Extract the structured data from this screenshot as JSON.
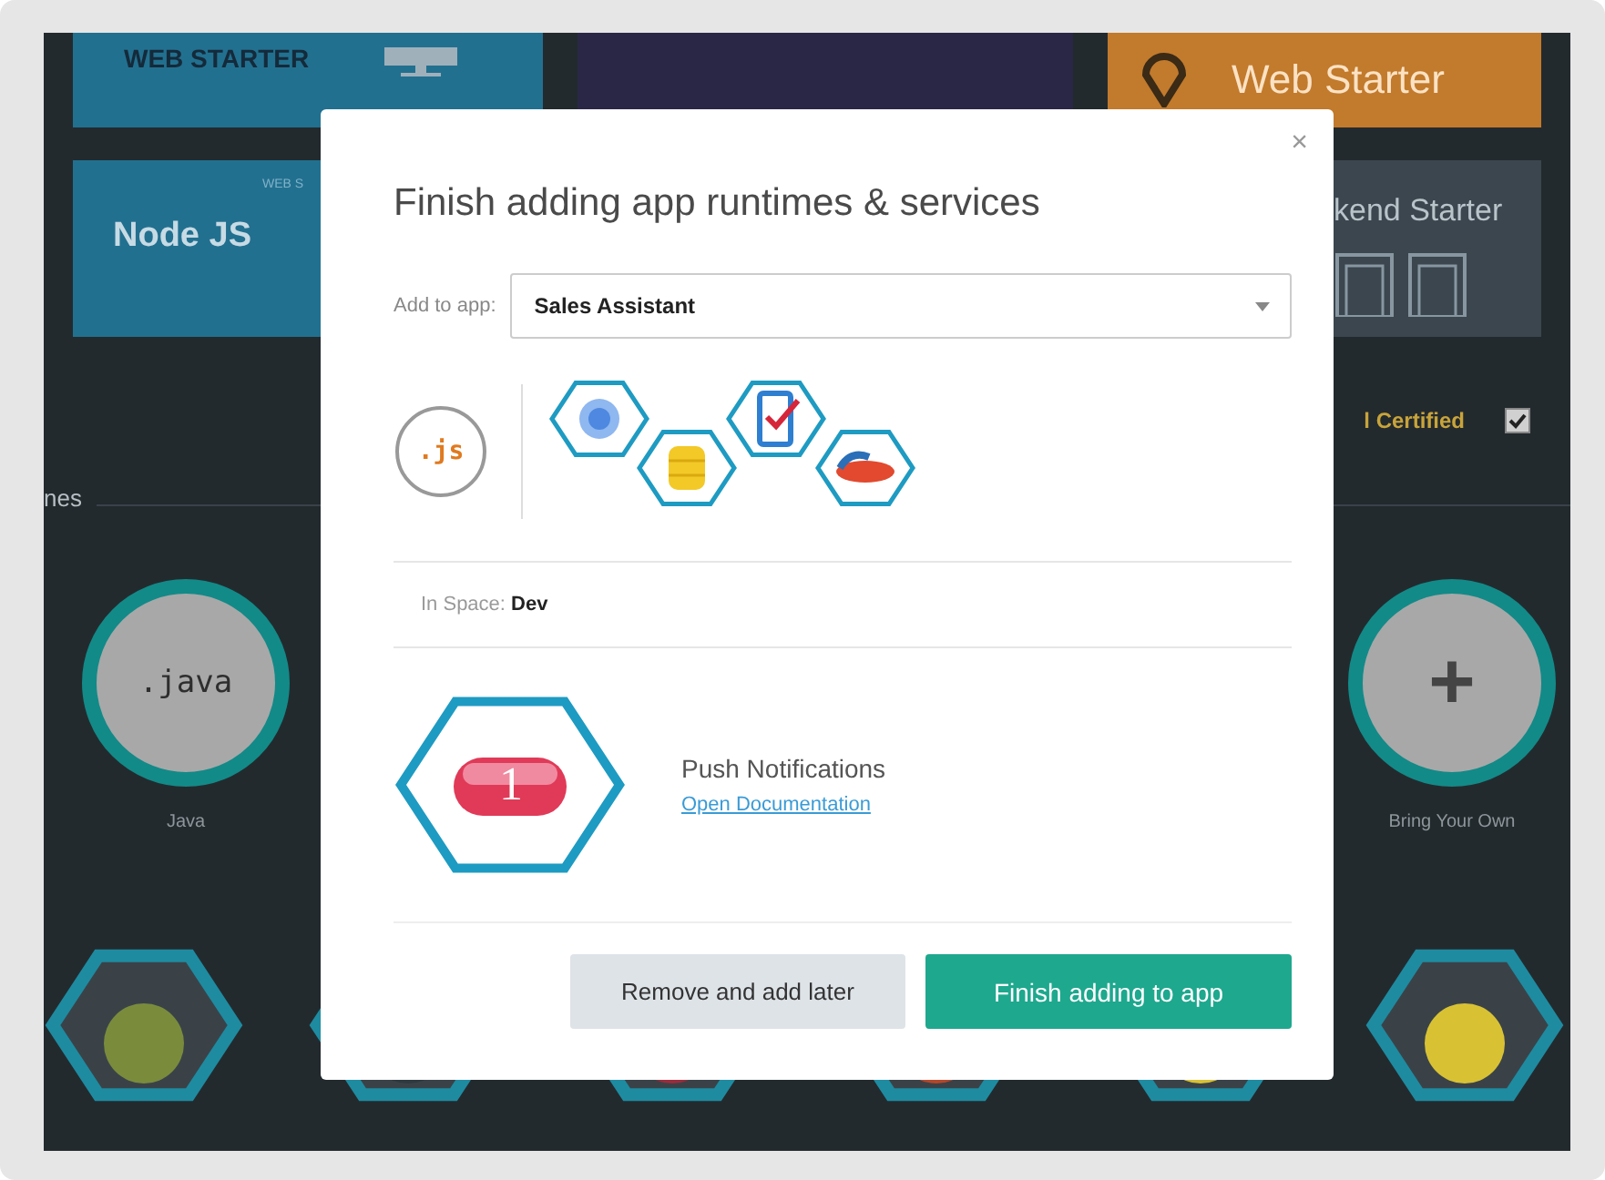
{
  "background": {
    "tiles": [
      {
        "kind": "blue",
        "title": "WEB STARTER"
      },
      {
        "kind": "purple"
      },
      {
        "kind": "orange",
        "title": "Web Starter"
      }
    ],
    "tiles_row_2": [
      {
        "kind": "blue",
        "caption": "WEB S",
        "title": "Node JS"
      },
      {
        "kind": "none"
      },
      {
        "kind": "grey",
        "title": "kend Starter"
      }
    ],
    "filter": {
      "label": "l Certified",
      "checked": true
    },
    "section_label": "nes",
    "runtimes": [
      {
        "kind": "code",
        "icon_text": ".java",
        "label": "Java"
      },
      {
        "kind": "add",
        "icon_text": "+",
        "label": "Bring Your Own"
      }
    ]
  },
  "modal": {
    "close": "×",
    "title": "Finish adding app runtimes & services",
    "add_to_app": {
      "label": "Add to app:",
      "value": "Sales Assistant"
    },
    "runtime_icon": ".js",
    "space": {
      "label": "In Space:",
      "value": "Dev"
    },
    "service": {
      "badge": "1",
      "name": "Push Notifications",
      "link": "Open Documentation"
    },
    "buttons": [
      {
        "kind": "secondary",
        "label": "Remove and add later"
      },
      {
        "kind": "primary",
        "label": "Finish adding to app"
      }
    ]
  }
}
